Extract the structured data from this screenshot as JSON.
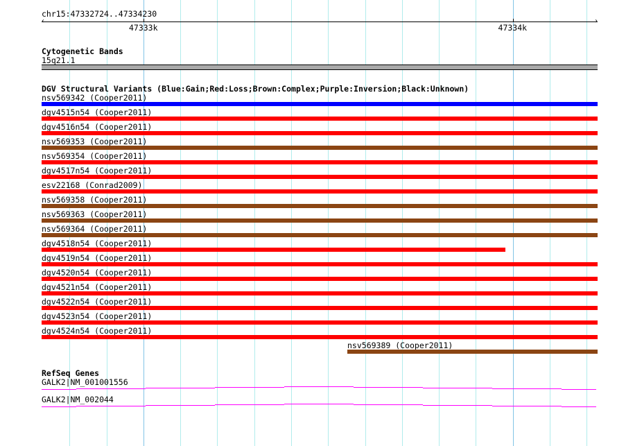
{
  "ruler": {
    "location": "chr15:47332724..47334230",
    "start": 47332724,
    "end": 47334230,
    "tick_labels": [
      {
        "pos": 47333000,
        "label": "47333k"
      },
      {
        "pos": 47334000,
        "label": "47334k"
      }
    ]
  },
  "cytoband": {
    "title": "Cytogenetic Bands",
    "band": "15q21.1"
  },
  "dgv": {
    "title": "DGV Structural Variants (Blue:Gain;Red:Loss;Brown:Complex;Purple:Inversion;Black:Unknown)",
    "colors": {
      "Gain": "#0000ff",
      "Loss": "#ff0000",
      "Complex": "#8b4513",
      "Inversion": "#800080",
      "Unknown": "#000000"
    },
    "variants": [
      {
        "label": "nsv569342 (Cooper2011)",
        "type": "Gain",
        "start": 47332724,
        "end": 47334230
      },
      {
        "label": "dgv4515n54 (Cooper2011)",
        "type": "Loss",
        "start": 47332724,
        "end": 47334230
      },
      {
        "label": "dgv4516n54 (Cooper2011)",
        "type": "Loss",
        "start": 47332724,
        "end": 47334230
      },
      {
        "label": "nsv569353 (Cooper2011)",
        "type": "Complex",
        "start": 47332724,
        "end": 47334230
      },
      {
        "label": "nsv569354 (Cooper2011)",
        "type": "Loss",
        "start": 47332724,
        "end": 47334230
      },
      {
        "label": "dgv4517n54 (Cooper2011)",
        "type": "Loss",
        "start": 47332724,
        "end": 47334230
      },
      {
        "label": "esv22168 (Conrad2009)",
        "type": "Loss",
        "start": 47332724,
        "end": 47334230
      },
      {
        "label": "nsv569358 (Cooper2011)",
        "type": "Complex",
        "start": 47332724,
        "end": 47334230
      },
      {
        "label": "nsv569363 (Cooper2011)",
        "type": "Complex",
        "start": 47332724,
        "end": 47334230
      },
      {
        "label": "nsv569364 (Cooper2011)",
        "type": "Complex",
        "start": 47332724,
        "end": 47334230
      },
      {
        "label": "dgv4518n54 (Cooper2011)",
        "type": "Loss",
        "start": 47332724,
        "end": 47333980
      },
      {
        "label": "dgv4519n54 (Cooper2011)",
        "type": "Loss",
        "start": 47332724,
        "end": 47334230
      },
      {
        "label": "dgv4520n54 (Cooper2011)",
        "type": "Loss",
        "start": 47332724,
        "end": 47334230
      },
      {
        "label": "dgv4521n54 (Cooper2011)",
        "type": "Loss",
        "start": 47332724,
        "end": 47334230
      },
      {
        "label": "dgv4522n54 (Cooper2011)",
        "type": "Loss",
        "start": 47332724,
        "end": 47334230
      },
      {
        "label": "dgv4523n54 (Cooper2011)",
        "type": "Loss",
        "start": 47332724,
        "end": 47334230
      },
      {
        "label": "dgv4524n54 (Cooper2011)",
        "type": "Loss",
        "start": 47332724,
        "end": 47334230
      },
      {
        "label": "nsv569389 (Cooper2011)",
        "type": "Complex",
        "start": 47333552,
        "end": 47334230
      }
    ]
  },
  "refseq": {
    "title": "RefSeq Genes",
    "color": "#ff00ff",
    "genes": [
      {
        "label": "GALK2|NM_001001556"
      },
      {
        "label": "GALK2|NM_002044"
      }
    ]
  }
}
